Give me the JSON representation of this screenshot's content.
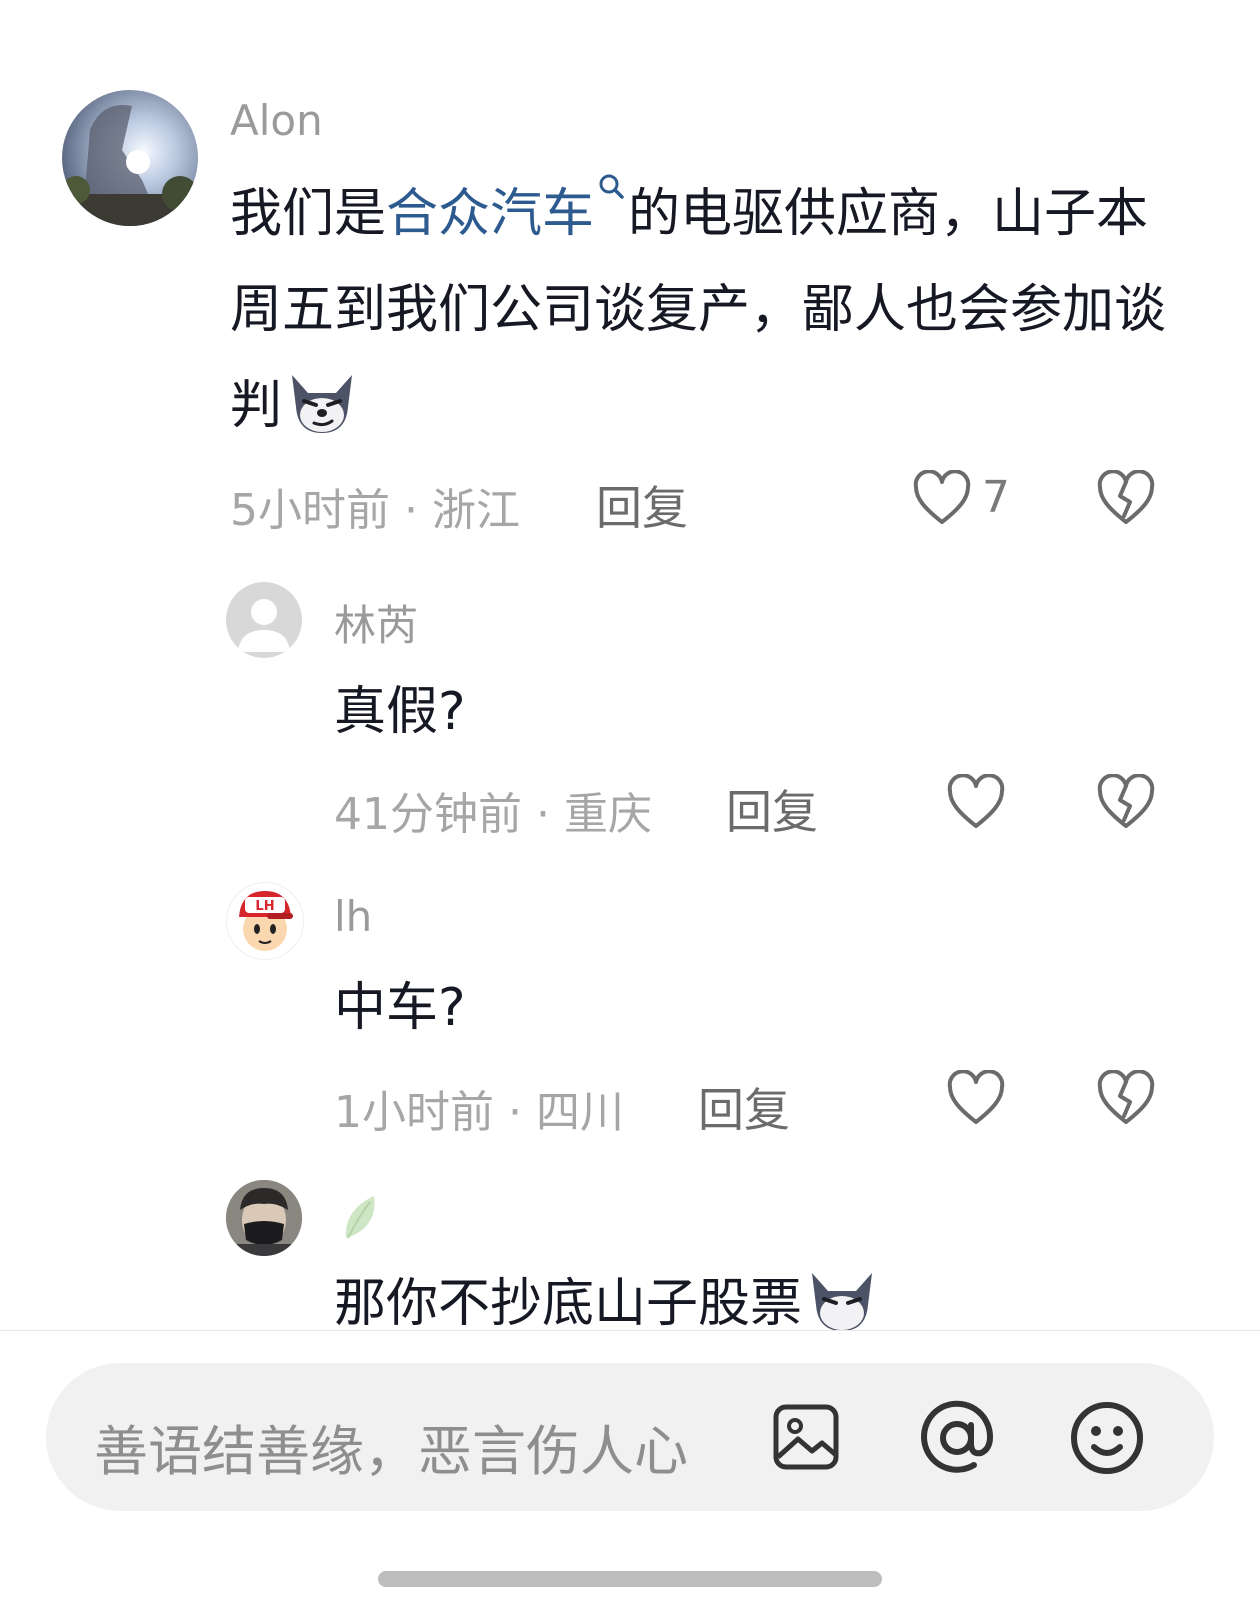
{
  "comments": [
    {
      "user": "Alon",
      "text_before": "我们是",
      "link_text": "合众汽车",
      "text_after": "的电驱供应商，山子本周五到我们公司谈复产，鄙人也会参加谈判",
      "emoji": "wolf-smirk-emoji",
      "time": "5小时前",
      "location": "浙江",
      "reply_label": "回复",
      "likes": "7"
    }
  ],
  "replies": [
    {
      "user": "林芮",
      "text": "真假?",
      "time": "41分钟前",
      "location": "重庆",
      "reply_label": "回复"
    },
    {
      "user": "lh",
      "avatar_badge": "LH",
      "text": "中车?",
      "time": "1小时前",
      "location": "四川",
      "reply_label": "回复"
    },
    {
      "user_icon": "leaf-icon",
      "text": "那你不抄底山子股票"
    }
  ],
  "meta_separator": "·",
  "input": {
    "placeholder": "善语结善缘，恶言伤人心",
    "image_icon": "image-icon",
    "mention_icon": "at-mention-icon",
    "emoji_icon": "emoji-smile-icon"
  },
  "colors": {
    "link": "#2e5b8f",
    "name": "#9a9a9a",
    "meta": "#a6a6a6",
    "input_bg": "#f1f1f2"
  }
}
